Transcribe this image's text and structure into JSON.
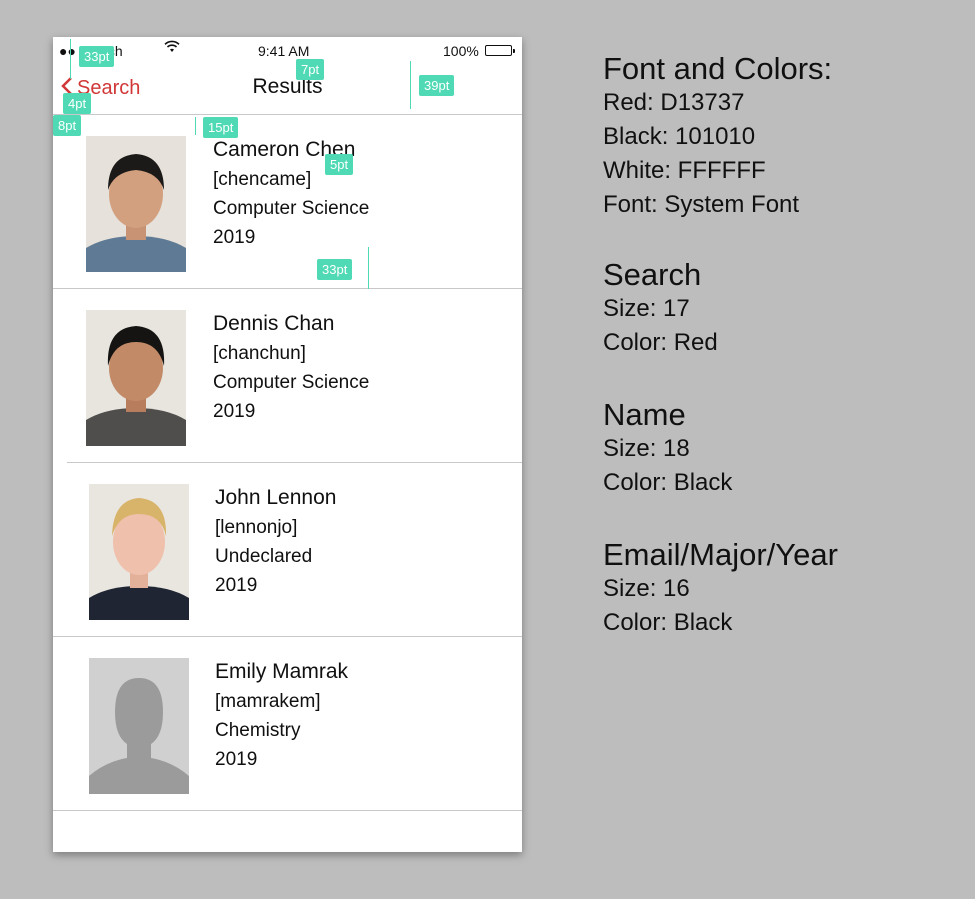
{
  "status_bar": {
    "carrier": "●● Sketch",
    "time": "9:41 AM",
    "battery": "100%"
  },
  "nav": {
    "back_label": "Search",
    "title": "Results"
  },
  "results": [
    {
      "name": "Cameron Chen",
      "email": "[chencame]",
      "major": "Computer Science",
      "year": "2019"
    },
    {
      "name": "Dennis Chan",
      "email": "[chanchun]",
      "major": "Computer Science",
      "year": "2019"
    },
    {
      "name": "John Lennon",
      "email": "[lennonjo]",
      "major": "Undeclared",
      "year": "2019"
    },
    {
      "name": "Emily Mamrak",
      "email": "[mamrakem]",
      "major": "Chemistry",
      "year": "2019"
    }
  ],
  "annotations": {
    "status_height": "33pt",
    "title_gap": "7pt",
    "nav_height": "39pt",
    "back_gap": "4pt",
    "left_margin": "8pt",
    "row_top": "15pt",
    "line_gap": "5pt",
    "row_bottom": "33pt"
  },
  "spec": {
    "colors_heading": "Font and Colors:",
    "red": "Red: D13737",
    "black": "Black: 101010",
    "white": "White: FFFFFF",
    "font": "Font: System Font",
    "search_heading": "Search",
    "search_size": "Size: 17",
    "search_color": "Color: Red",
    "name_heading": "Name",
    "name_size": "Size: 18",
    "name_color": "Color: Black",
    "detail_heading": "Email/Major/Year",
    "detail_size": "Size: 16",
    "detail_color": "Color: Black"
  },
  "theme": {
    "red": "#D13737",
    "black": "#101010",
    "white": "#FFFFFF",
    "annotation": "#4fd9b4"
  }
}
